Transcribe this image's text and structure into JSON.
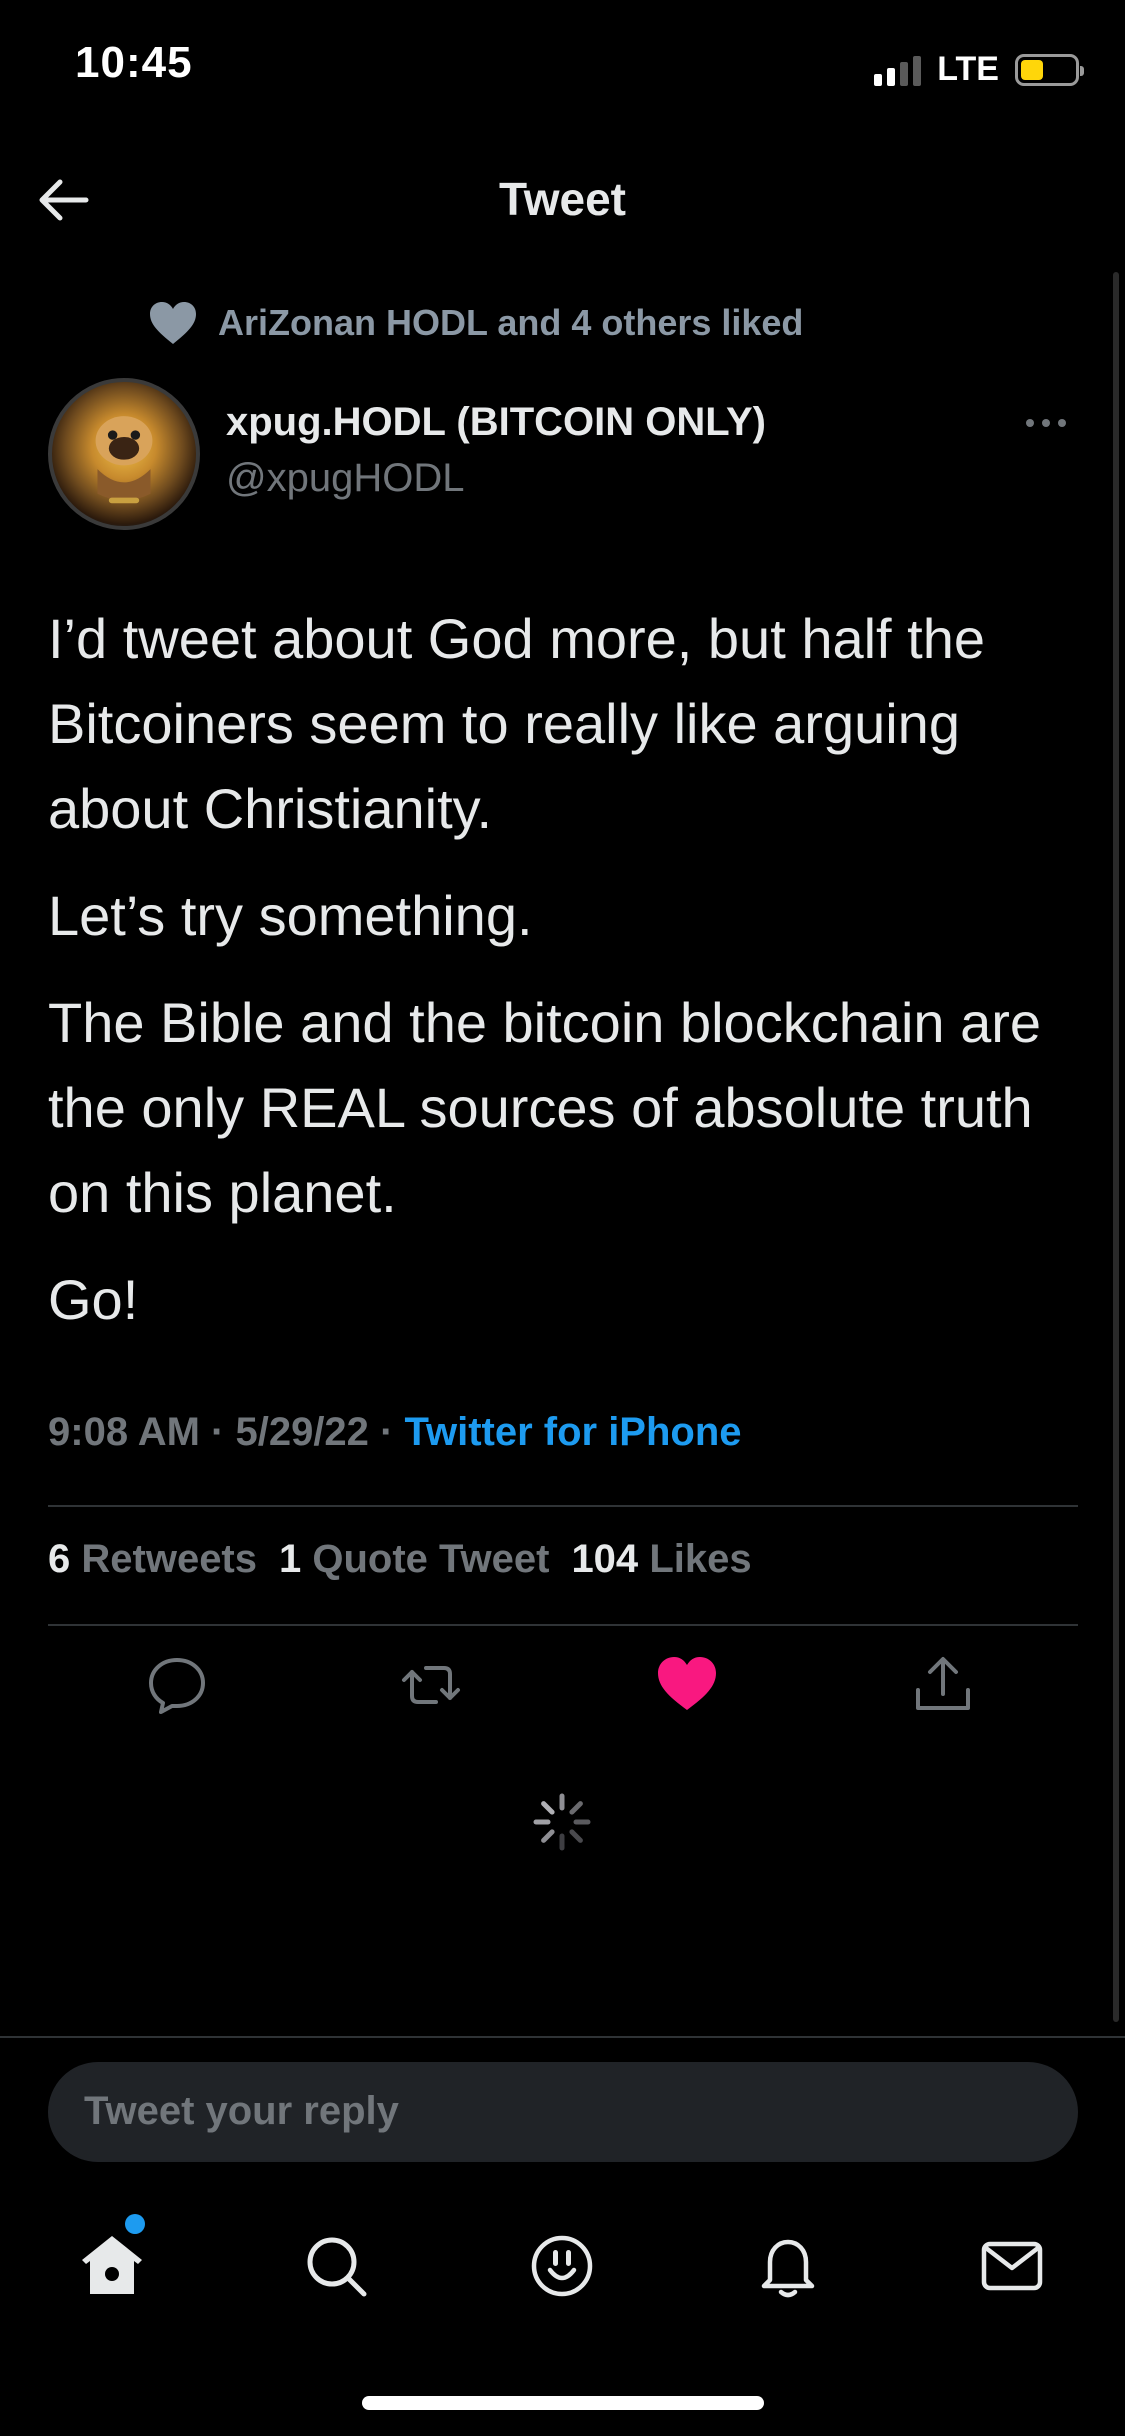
{
  "status_bar": {
    "time": "10:45",
    "network": "LTE",
    "battery_color": "#ffd60a"
  },
  "header": {
    "title": "Tweet"
  },
  "tweet": {
    "social_context": "AriZonan HODL and 4 others liked",
    "author_name": "xpug.HODL (BITCOIN ONLY)",
    "author_handle": "@xpugHODL",
    "paragraphs": [
      "I’d tweet about God more, but half the Bitcoiners seem to really like arguing about Christianity.",
      "Let’s try something.",
      "The Bible and the bitcoin blockchain are the only REAL sources of absolute truth on this planet.",
      "Go!"
    ],
    "time": "9:08 AM",
    "date": "5/29/22",
    "source": "Twitter for iPhone",
    "stats": {
      "retweets_count": "6",
      "retweets_label": "Retweets",
      "quotes_count": "1",
      "quotes_label": "Quote Tweet",
      "likes_count": "104",
      "likes_label": "Likes"
    },
    "liked": true
  },
  "actions": [
    "reply-icon",
    "retweet-icon",
    "like-icon",
    "share-icon"
  ],
  "reply": {
    "placeholder": "Tweet your reply"
  },
  "tab_bar": [
    "home-icon",
    "search-icon",
    "spaces-icon",
    "notifications-icon",
    "messages-icon"
  ],
  "colors": {
    "accent": "#1d9bf0",
    "like": "#f91880",
    "muted": "#71767b",
    "background": "#000000"
  }
}
